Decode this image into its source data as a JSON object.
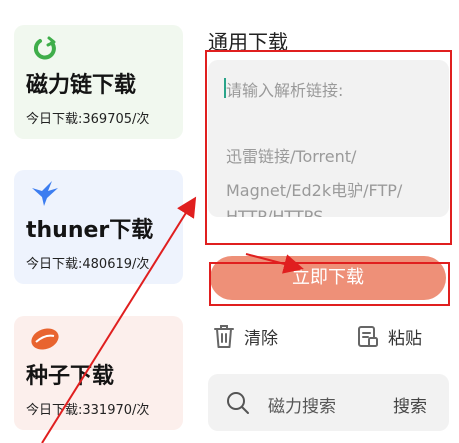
{
  "cards": [
    {
      "title": "磁力链下载",
      "count": "今日下载:369705/次",
      "icon": "magnet-icon"
    },
    {
      "title": "thuner下载",
      "count": "今日下载:480619/次",
      "icon": "thunder-bird-icon"
    },
    {
      "title": "种子下载",
      "count": "今日下载:331970/次",
      "icon": "seed-icon"
    }
  ],
  "main": {
    "section_title": "通用下载",
    "placeholder_line1": "请输入解析链接:",
    "placeholder_line2": "迅雷链接/Torrent/",
    "placeholder_line3": "Magnet/Ed2k电驴/FTP/",
    "placeholder_line4": "HTTP/HTTPS",
    "download_now": "立即下载",
    "clear_label": "清除",
    "paste_label": "粘贴"
  },
  "search": {
    "placeholder": "磁力搜索",
    "button": "搜索"
  },
  "colors": {
    "accent": "#ee9078",
    "annotation_red": "#e01f1f",
    "magnet_card_bg": "#f1f8ef",
    "thunder_card_bg": "#eef3fd",
    "seed_card_bg": "#fcefec"
  }
}
